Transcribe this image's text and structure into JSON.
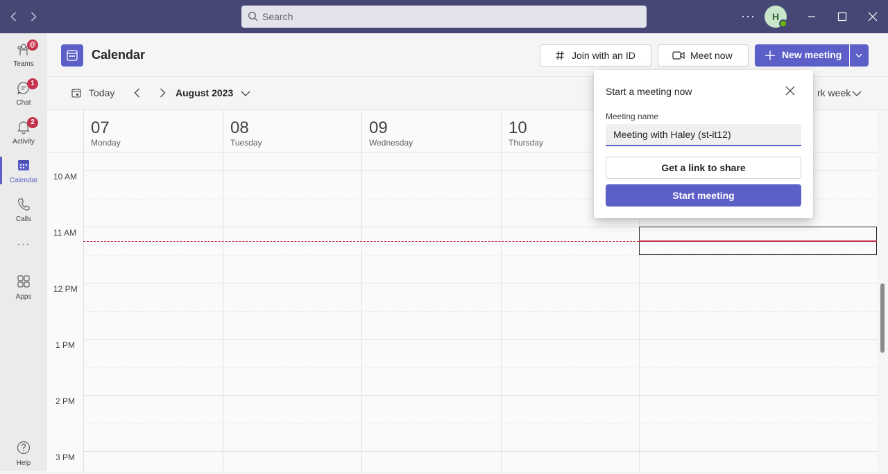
{
  "titlebar": {
    "search_placeholder": "Search",
    "avatar_initial": "H",
    "more": "···"
  },
  "rail": {
    "items": [
      {
        "label": "Teams",
        "badge": "@",
        "icon": "teams-icon"
      },
      {
        "label": "Chat",
        "badge": "1",
        "icon": "chat-icon"
      },
      {
        "label": "Activity",
        "badge": "2",
        "icon": "bell-icon"
      },
      {
        "label": "Calendar",
        "badge": "",
        "icon": "calendar-icon"
      },
      {
        "label": "Calls",
        "badge": "",
        "icon": "phone-icon"
      },
      {
        "label": "Apps",
        "badge": "",
        "icon": "apps-icon"
      },
      {
        "label": "Help",
        "badge": "",
        "icon": "help-icon"
      }
    ],
    "more": "···"
  },
  "header": {
    "title": "Calendar",
    "join_id": "Join with an ID",
    "meet_now": "Meet now",
    "new_meeting": "New meeting"
  },
  "toolbar": {
    "today": "Today",
    "month": "August 2023",
    "view": "rk week"
  },
  "days": [
    {
      "num": "07",
      "name": "Monday"
    },
    {
      "num": "08",
      "name": "Tuesday"
    },
    {
      "num": "09",
      "name": "Wednesday"
    },
    {
      "num": "10",
      "name": "Thursday"
    }
  ],
  "times": [
    "10 AM",
    "11 AM",
    "12 PM",
    "1 PM",
    "2 PM",
    "3 PM"
  ],
  "popup": {
    "title": "Start a meeting now",
    "field_label": "Meeting name",
    "meeting_name": "Meeting with Haley (st-it12)",
    "link_button": "Get a link to share",
    "start_button": "Start meeting"
  },
  "colors": {
    "brand": "#464775",
    "accent": "#5b5fc7",
    "alert": "#c4314b",
    "presence": "#6bb700"
  }
}
